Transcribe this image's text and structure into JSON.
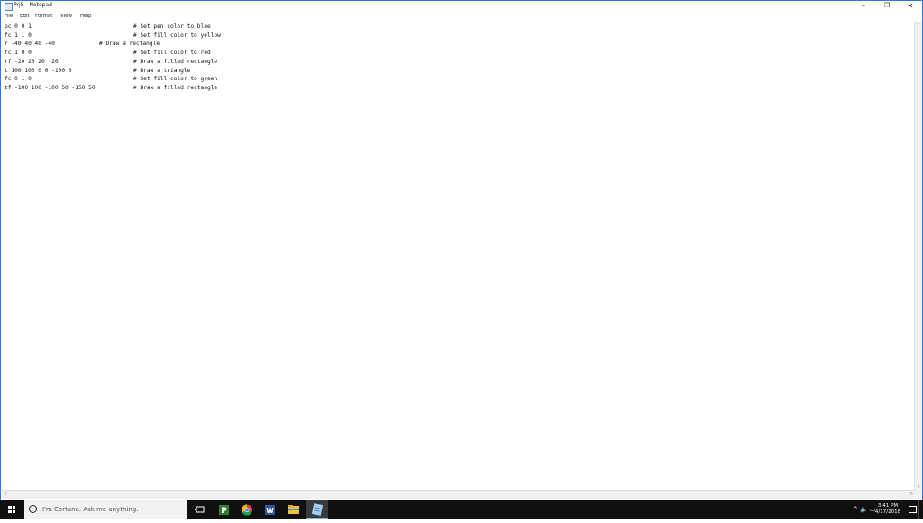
{
  "window": {
    "title": "Prj5 - Notepad",
    "minimize": "–",
    "restore": "❐",
    "close": "✕"
  },
  "menu": [
    "File",
    "Edit",
    "Format",
    "View",
    "Help"
  ],
  "lines": [
    {
      "code": "pc 0 0 1",
      "comment": "# Set pen color to blue"
    },
    {
      "code": "fc 1 1 0",
      "comment": "# Set fill color to yellow"
    },
    {
      "code": "r -40 40 40 -40",
      "comment": "# Draw a rectangle"
    },
    {
      "code": "fc 1 0 0",
      "comment": "# Set fill color to red"
    },
    {
      "code": "rf -20 20 20 -20",
      "comment": "# Draw a filled rectangle"
    },
    {
      "code": "t 100 100 0 0 -100 0",
      "comment": "# Draw a triangle"
    },
    {
      "code": "fc 0 1 0",
      "comment": "# Set fill color to green"
    },
    {
      "code": "tf -100 100 -100 50 -150 50",
      "comment": "# Draw a filled rectangle"
    }
  ],
  "scrollbar": {
    "left": "<",
    "right": ">",
    "up": "^",
    "down": "v"
  },
  "taskbar": {
    "search_placeholder": "I'm Cortana. Ask me anything.",
    "apps": [
      "task-view",
      "publisher",
      "chrome",
      "word",
      "file-explorer",
      "notepad"
    ],
    "tray_icons": "^  🔈  ▭",
    "time": "3:41 PM",
    "date": "4/17/2018"
  },
  "colors": {
    "accent": "#2b7bd6",
    "taskbar": "#101010"
  }
}
